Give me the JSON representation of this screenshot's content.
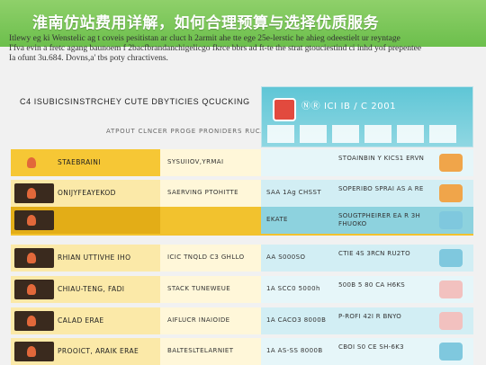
{
  "header": {
    "title": "淮南仿站费用详解，如何合理预算与选择优质服务"
  },
  "intro_lines": [
    "Itlewy eg ki Wenstelic ag t coveis pesitistan ar cluct h 2armit ahe tte ege 25e-lerstic he ahieg odeestielt ur reyntage",
    "I'fva evin a fretc agang baunoem f 2bacfbrandanchigelicgo fkrce bbrs ad ft-te the strat gtouciestind ci inhd yof prepentee",
    "Ia ofunt 3u.684. Dovns,a' tbs poty chractivens."
  ],
  "table": {
    "heading": "C4 ISUBICSINSTRCHEY CUTE DBYTICIES QCUCKING",
    "subheading": "ATPOUT CLNCER PROGE PRONIDERS  RUCAFTNG",
    "panel_text": "ⓃⓇ ICI IB / C 2001",
    "rows": [
      {
        "c1": "STAEBRAINI",
        "c2": "SYSUIIOV,YRMAI",
        "c3": "",
        "c4": "STOAINBIN Y KICS1 ERVN",
        "icon": "orange-box-icon",
        "style": "header"
      },
      {
        "c1": "ONIJYFEAYEKOD",
        "c2": "SAERVING PTOHITTE",
        "c3": "SAA 1Ag CHSST",
        "c4": "SOPERIBO SPRAI AS A RE",
        "icon": "orange-box-icon",
        "style": "normal"
      },
      {
        "c1": "",
        "c2": "",
        "c3": "EKATE",
        "c4": "SOUGTPHEIRER EA R 3H FHUOKO",
        "icon": "blue-box-icon",
        "style": "highlight"
      },
      {
        "c1": "RHIAN UTTIVHE IHO",
        "c2": "ICIC TNQLD C3 GHLLO",
        "c3": "AA S000SO",
        "c4": "CTIE 4S 3RCN RU2TO",
        "icon": "blue-box-icon",
        "style": "normal"
      },
      {
        "c1": "CHIAU-TENG, FADI",
        "c2": "STACK TUNEWEUE",
        "c3": "1A   SCC0 5000h",
        "c4": "500B 5 80 CA H6KS",
        "icon": "pink-box-icon",
        "style": "normal"
      },
      {
        "c1": "CALAD ERAE",
        "c2": "AIFLUCR INAIOIDE",
        "c3": "1A   CACO3 8000B",
        "c4": "P-ROFI 42I R BNYO",
        "icon": "pink-box-icon",
        "style": "normal"
      },
      {
        "c1": "PROOICT, ARAIK ERAE",
        "c2": "BALTESLTELARNIET",
        "c3": "1A   AS-SS 8000B",
        "c4": "CBOI S0 CE SH-6K3",
        "icon": "blue-box-icon",
        "style": "normal"
      }
    ]
  },
  "colors": {
    "title_bar": "#6cbf4c",
    "yellow": "#f6c735",
    "teal": "#5fc6d6"
  }
}
